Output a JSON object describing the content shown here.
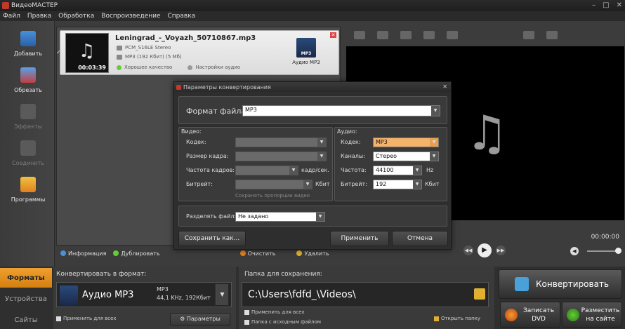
{
  "window": {
    "title": "ВидеоМАСТЕР"
  },
  "menu": [
    "Файл",
    "Правка",
    "Обработка",
    "Воспроизведение",
    "Справка"
  ],
  "left_tools": [
    {
      "label": "Добавить",
      "icon": "add-video-icon"
    },
    {
      "label": "Обрезать",
      "icon": "cut-icon"
    },
    {
      "label": "Эффекты",
      "icon": "effects-icon"
    },
    {
      "label": "Соединить",
      "icon": "join-icon"
    },
    {
      "label": "Программы",
      "icon": "programs-icon"
    }
  ],
  "file": {
    "name": "Leningrad_-_Voyazh_50710867.mp3",
    "duration": "00:03:39",
    "audio_line1": "PCM_S16LE Stereo",
    "audio_line2": "MP3 (192 Кбит) (5 Мб)",
    "quality": "Хорошее качество",
    "audio_settings": "Настройки аудио",
    "format_label": "Аудио MP3",
    "format_badge": "MP3"
  },
  "listbar": {
    "info": "Информация",
    "duplicate": "Дублировать",
    "clear": "Очистить",
    "delete": "Удалить"
  },
  "player": {
    "time": "00:00:00"
  },
  "dialog": {
    "title": "Параметры конвертирования",
    "file_format_label": "Формат файла",
    "file_format_value": "MP3",
    "video_section": "Видео:",
    "audio_section": "Аудио:",
    "video": {
      "codec": "Кодек:",
      "frame_size": "Размер кадра:",
      "frame_rate": "Частота кадров:",
      "frame_rate_unit": "кадр/сек.",
      "bitrate": "Битрейт:",
      "bitrate_unit": "Кбит",
      "keep_aspect": "Сохранять пропорции видео"
    },
    "audio": {
      "codec_label": "Кодек:",
      "codec_value": "MP3",
      "channels_label": "Каналы:",
      "channels_value": "Стерео",
      "rate_label": "Частота:",
      "rate_value": "44100",
      "rate_unit": "Hz",
      "bitrate_label": "Битрейт:",
      "bitrate_value": "192",
      "bitrate_unit": "Кбит"
    },
    "split_label": "Разделять файл:",
    "split_value": "Не задано",
    "save_as": "Сохранить как...",
    "apply": "Применить",
    "cancel": "Отмена"
  },
  "bottom": {
    "tabs": [
      "Форматы",
      "Устройства",
      "Сайты"
    ],
    "convert_to_label": "Конвертировать в формат:",
    "format_name": "Аудио MP3",
    "format_sub1": "MP3",
    "format_sub2": "44,1 KHz, 192Кбит",
    "apply_all": "Применить для всех",
    "params": "Параметры",
    "folder_label": "Папка для сохранения:",
    "folder_path": "C:\\Users\\fdfd_\\Videos\\",
    "folder_apply_all": "Применить для всех",
    "folder_source": "Папка с исходным файлом",
    "open_folder": "Открыть папку",
    "convert": "Конвертировать",
    "burn_dvd": "Записать DVD",
    "publish": "Разместить на сайте"
  },
  "colors": {
    "accent": "#e89a20",
    "selected_field": "#f4b36b"
  }
}
